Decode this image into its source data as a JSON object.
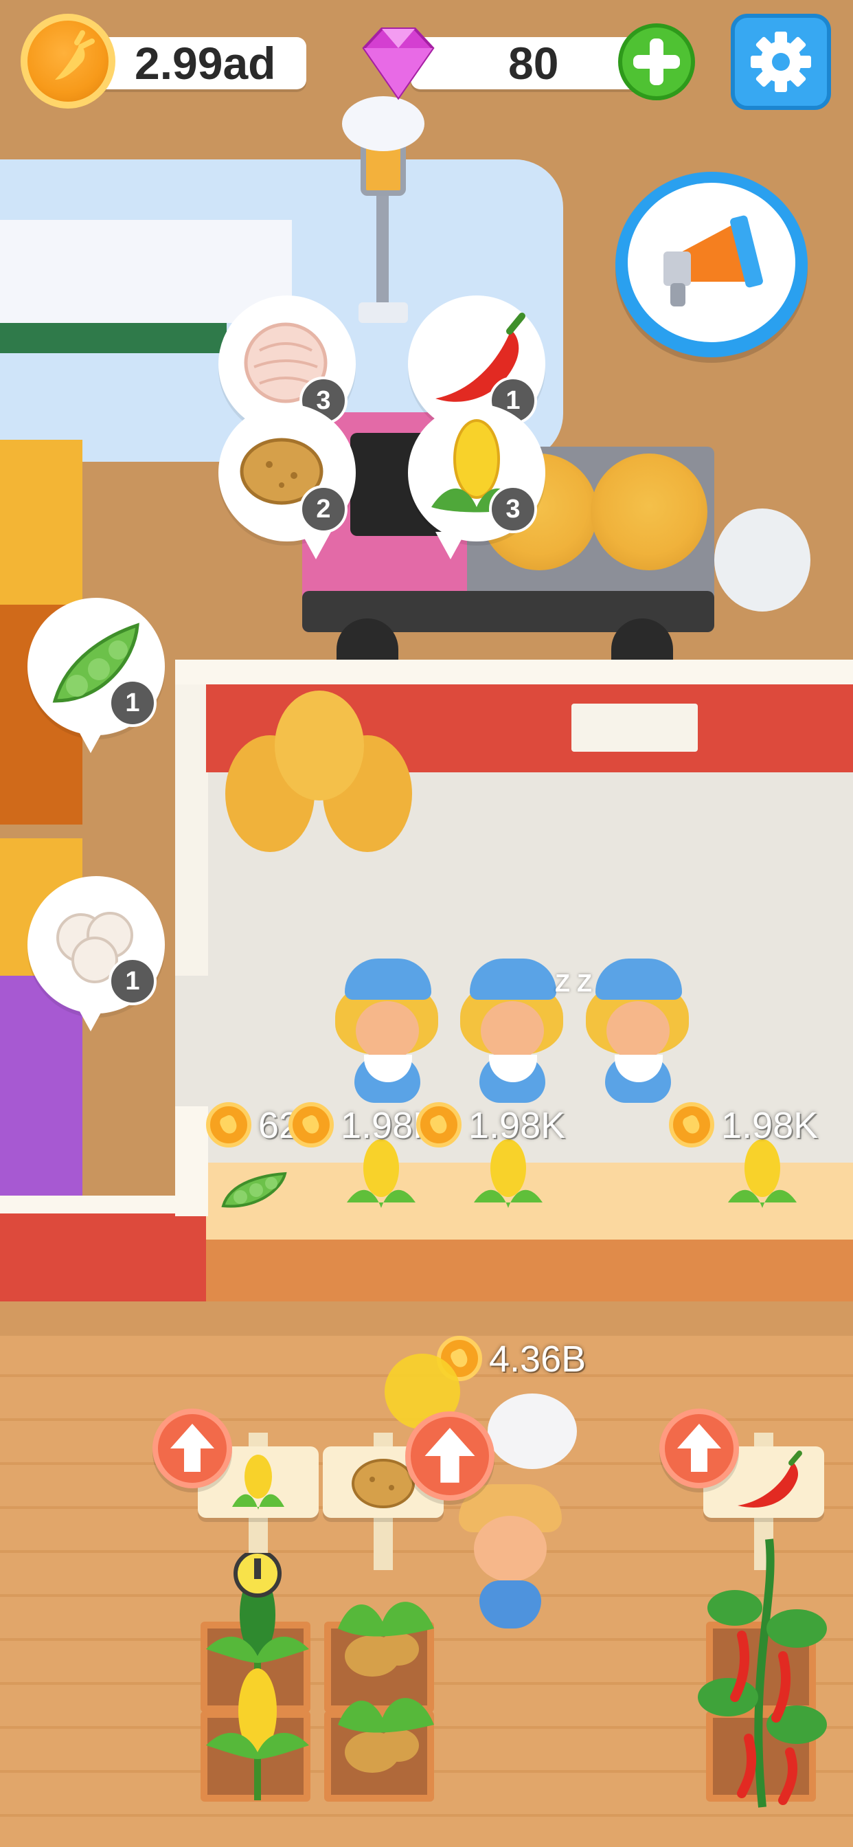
{
  "hud": {
    "coins": "2.99ad",
    "gems": "80"
  },
  "icons": {
    "coin": "carrot-coin-icon",
    "gem": "pink-gem-icon",
    "add": "plus-icon",
    "settings": "gear-icon",
    "promo": "megaphone-icon",
    "upgrade": "up-arrow-icon"
  },
  "truck_orders": [
    {
      "item": "onion",
      "count": "3"
    },
    {
      "item": "chili pepper",
      "count": "1"
    },
    {
      "item": "potato",
      "count": "2"
    },
    {
      "item": "corn",
      "count": "3"
    }
  ],
  "side_orders": [
    {
      "item": "edamame",
      "count": "1"
    },
    {
      "item": "cotton",
      "count": "1"
    }
  ],
  "counter": {
    "earnings": [
      "62",
      "1.98K",
      "1.98K",
      "1.98K"
    ],
    "sleep_text": "Z Z"
  },
  "farm": {
    "carry_amount": "4.36B",
    "crops": [
      "corn",
      "potato",
      "chili pepper"
    ]
  },
  "colors": {
    "background": "#c9955e",
    "accent_green": "#4fc233",
    "accent_blue": "#37a8f2",
    "upgrade_red": "#f26a4a",
    "wall_red": "#dd4a3c",
    "gem_pink": "#d43fd1",
    "coin_orange": "#f7a21f"
  }
}
